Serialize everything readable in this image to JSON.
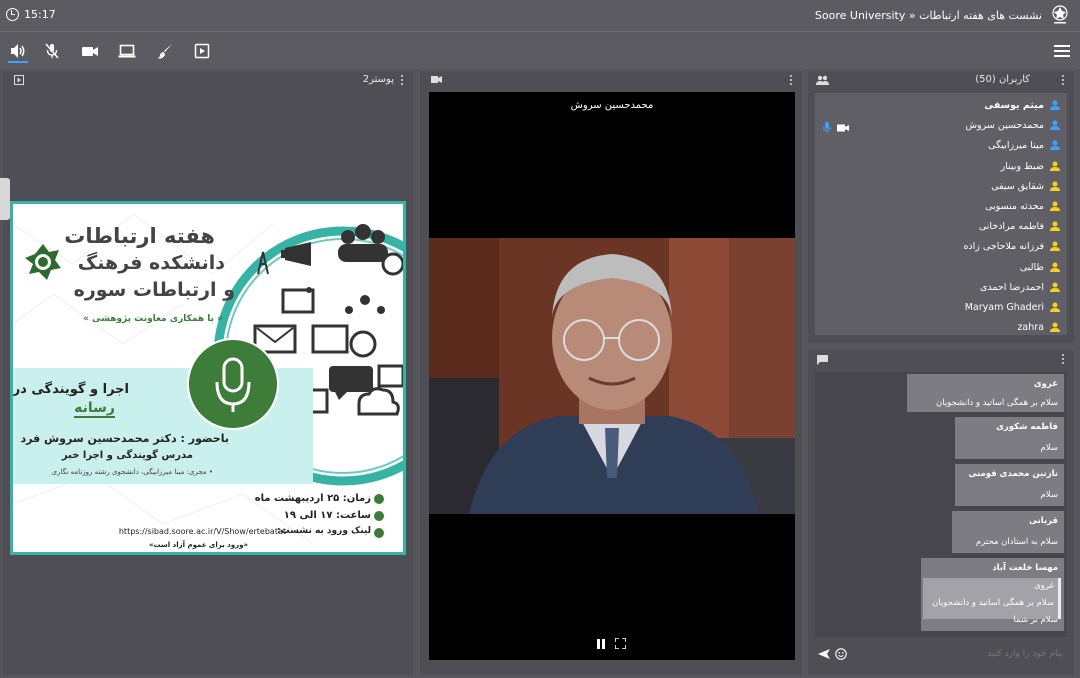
{
  "titlebar": {
    "time": "15:17",
    "title": "Soore University » نشست های هفته ارتباطات"
  },
  "toolbar": {
    "icons": [
      "speaker-icon",
      "mic-off-icon",
      "camera-icon",
      "screen-share-icon",
      "brush-icon",
      "play-presentation-icon"
    ],
    "menu_icon": "hamburger-menu-icon"
  },
  "poster_panel": {
    "title": "پوستر2"
  },
  "poster": {
    "title_line1": "هفته ارتباطات",
    "title_line2": "دانشکده فرهنگ",
    "title_line3": "و ارتباطات سوره",
    "subtitle": "« با همکاری معاونت پژوهشی »",
    "topic_line1": "اجرا و گویندگی در",
    "topic_line2": "رسانه",
    "presenter_line1": "باحضور : دکتر محمدحسین سروش فرد",
    "presenter_line2": "مدرس گویندگی و اجرا خبر",
    "host": "• مجری: مینا میرزابیگی، دانشجوی رشته روزنامه نگاری",
    "date": "زمان: ۲۵ اردیبهشت ماه",
    "hour": "ساعت: ۱۷ الی ۱۹",
    "link_label": "لینک ورود به نشست:",
    "link_url": "https://sibad.soore.ac.ir/V/Show/ertebatat",
    "public_note": "«ورود برای عموم آزاد است»",
    "accent_color": "#3e7c3a",
    "teal_color": "#37b3a5"
  },
  "video_panel": {
    "speaker_name": "محمدحسین سروش"
  },
  "users_panel": {
    "title": "کاربران (50)",
    "users": [
      {
        "name": "میثم یوسفی",
        "role": "moderator",
        "bold": true
      },
      {
        "name": "محمدحسین سروش",
        "role": "moderator",
        "bold": false
      },
      {
        "name": "مینا میرزابیگی",
        "role": "moderator",
        "bold": false
      },
      {
        "name": "ضبط وبینار",
        "role": "viewer",
        "bold": false
      },
      {
        "name": "شقایق سیفی",
        "role": "viewer",
        "bold": false
      },
      {
        "name": "محدثه منسوبی",
        "role": "viewer",
        "bold": false
      },
      {
        "name": "فاطمه مرادخانی",
        "role": "viewer",
        "bold": false
      },
      {
        "name": "فرزانه ملاحاجی زاده",
        "role": "viewer",
        "bold": false
      },
      {
        "name": "طالبی",
        "role": "viewer",
        "bold": false
      },
      {
        "name": "احمدرضا احمدی",
        "role": "viewer",
        "bold": false
      },
      {
        "name": "Maryam Ghaderi",
        "role": "viewer",
        "bold": false
      },
      {
        "name": "zahra",
        "role": "viewer",
        "bold": false
      }
    ],
    "colors": {
      "moderator": "#3ea0ff",
      "viewer": "#f5d020"
    }
  },
  "chat": {
    "messages": [
      {
        "sender": "غروی",
        "text": "سلام بر همگی اساتید و دانشجویان"
      },
      {
        "sender": "فاطمه شکوری",
        "text": "سلام"
      },
      {
        "sender": "نازنین محمدی قومنی",
        "text": "سلام"
      },
      {
        "sender": "قربانی",
        "text": "سلام به استادان محترم"
      },
      {
        "sender": "مهسا خلعت آباد",
        "quote_sender": "غروی",
        "quote_text": "سلام بر همگی اساتید و دانشجویان",
        "text": "سلام بر شما"
      }
    ],
    "input_placeholder": "پیام خود را وارد کنید"
  }
}
